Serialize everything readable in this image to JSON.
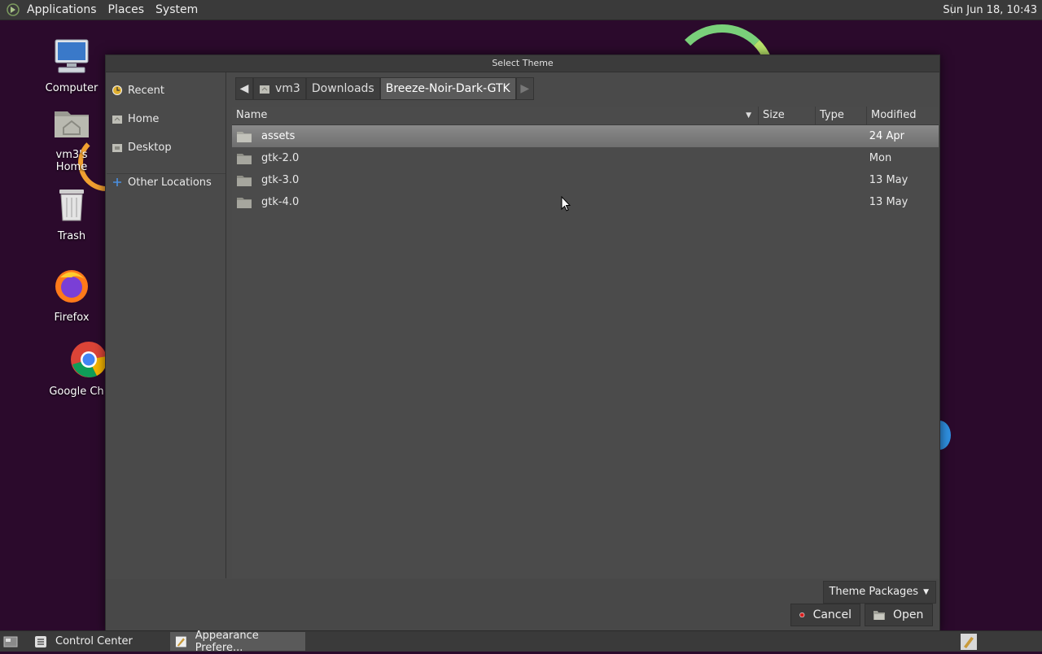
{
  "top_panel": {
    "menus": [
      "Applications",
      "Places",
      "System"
    ],
    "clock": "Sun Jun 18, 10:43"
  },
  "desktop": {
    "icons": [
      {
        "label": "Computer"
      },
      {
        "label": "vm3's Home"
      },
      {
        "label": "Trash"
      },
      {
        "label": "Firefox"
      },
      {
        "label": "Google Ch"
      }
    ]
  },
  "dialog": {
    "title": "Select Theme",
    "sidebar": {
      "items": [
        "Recent",
        "Home",
        "Desktop",
        "Other Locations"
      ]
    },
    "pathbar": {
      "segments": [
        "vm3",
        "Downloads",
        "Breeze-Noir-Dark-GTK"
      ]
    },
    "columns": {
      "name": "Name",
      "size": "Size",
      "type": "Type",
      "modified": "Modified"
    },
    "files": [
      {
        "name": "assets",
        "size": "",
        "type": "",
        "modified": "24 Apr"
      },
      {
        "name": "gtk-2.0",
        "size": "",
        "type": "",
        "modified": "Mon"
      },
      {
        "name": "gtk-3.0",
        "size": "",
        "type": "",
        "modified": "13 May"
      },
      {
        "name": "gtk-4.0",
        "size": "",
        "type": "",
        "modified": "13 May"
      }
    ],
    "filter": "Theme Packages",
    "buttons": {
      "cancel": "Cancel",
      "open": "Open"
    }
  },
  "taskbar": {
    "tasks": [
      "Control Center",
      "Appearance Prefere..."
    ]
  }
}
